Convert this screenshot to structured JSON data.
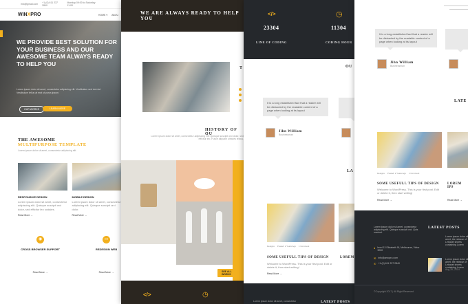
{
  "brand": {
    "logo_left": "WIN",
    "logo_x": "X",
    "logo_right": "PRO"
  },
  "topbar": {
    "email": "info@gmail.com",
    "phone": "+1-(0) 611 237 2840",
    "hours": "Monday 09:00 to Saturday 11:00"
  },
  "nav": {
    "home": "HOME ▾",
    "about": "ABOU"
  },
  "hero": {
    "headline": "WE PROVIDE BEST SOLUTION FOR YOUR BUSINESS AND OUR AWESOME TEAM ALWAYS READY TO HELP YOU",
    "sub": "Lorem ipsum dolor sit amet, consectetur adipiscing elit. Vestibulum sed dui nisl. Vestibulum tellus at erat ut purus ipsum.",
    "btn1": "OUR WORKS",
    "btn2": "LEARN MORE"
  },
  "intro": {
    "title1": "THE AWESOME",
    "title2": "MULTIPURPOSE TEMPLATE",
    "desc": "Lorem ipsum dolor sit amet, consectetur adipiscing elit."
  },
  "features": [
    {
      "title": "RESPONSIVE DESIGN",
      "text": "Lorem ipsum dolor sit amet, consectetur adipiscing elit. Quisque suscipit orci dolor, sed efficitur leo sodales.",
      "more": "Read More →"
    },
    {
      "title": "MOBILE DESIGN",
      "text": "Lorem ipsum dolor sit amet, consectetur adipiscing elit. Quisque suscipit orci dolor.",
      "more": "Read More →"
    }
  ],
  "services": [
    {
      "title": "CROSS BROWSER SUPPORT",
      "more": "Read More →"
    },
    {
      "title": "REDESIGN WEB",
      "more": "Read More →"
    }
  ],
  "banner": {
    "ready": "WE ARE ALWAYS READY TO HELP YOU"
  },
  "history": {
    "title": "HISTORY OF OU",
    "text": "Lorem ipsum dolor sit amet, consectetur adipiscing elit. Quisque suscipit orci dolor, sed efficitur leo. Fusce aliquam ultricies lectus."
  },
  "portfolio": {
    "all_btn": "SEE ALL WORKS"
  },
  "about_block": {
    "heading": "T",
    "text": "Lorem ipsum dolor sit amet, consectetur adipiscing elit."
  },
  "stats": [
    {
      "value": "23304",
      "label": "LINE OF CODING"
    },
    {
      "value": "11304",
      "label": "CODING HOUR"
    }
  ],
  "testimonials": {
    "section": "OU",
    "quote": "It is a long established fact that a reader will be distracted by the readable content of a page when looking at its layout",
    "name": "Jihn William",
    "role": "Businessman"
  },
  "blog": {
    "section": "LA",
    "title": "SOME USEFULL TIPS OF DESIGN",
    "title2": "LOREM",
    "meta1": "Designs",
    "meta2": "Posted: 2 Years Ago",
    "meta3": "1 Comment",
    "text": "Welcome to WordPress. This is your first post. Edit or delete it, then start writing!",
    "more": "Read More →"
  },
  "right": {
    "quote": "It is a long established fact that a reader will be distracted by the readable content of a page when looking at its layout",
    "name": "Jihn William",
    "role": "Businessman",
    "latest": "LATE",
    "title": "SOME USEFULL TIPS OF DESIGN",
    "title2": "LOREM IPS",
    "meta1": "Designs",
    "meta2": "Posted: 2 Years Ago",
    "meta3": "1 Comment",
    "text": "Welcome to WordPress. This is your first post. Edit or delete it, then start writing!",
    "more": "Read More →"
  },
  "footer": {
    "about": "Lorem ipsum dolor sit amet, consectetur adipiscing elit. Quisque suscipit orci. Quis nostrud.",
    "address": "level 13 Elizabeth St, Melbourne, Victor 3000",
    "email": "info@amopro.com",
    "phone": "+1-(0) 611 237 2840",
    "latest_title": "LATEST POSTS",
    "post_text": "Lorem ipsum dolor sit amet, the release of Letraset sheets containing Lorem",
    "post_date": "Aug 20, 2014",
    "copyright": "©Copyright 2017 | All Right Reserved",
    "bottom_latest": "LATEST POSTS",
    "bottom_text": "Lorem ipsum dolor sit amet, consectetur"
  },
  "colors": {
    "accent": "#f2b01e",
    "dark": "#22262b"
  }
}
